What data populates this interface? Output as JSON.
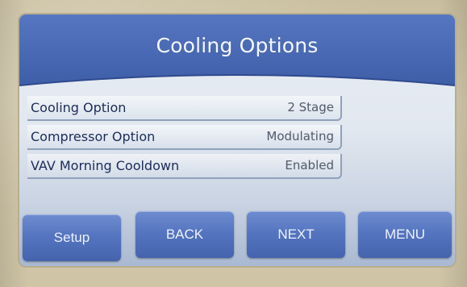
{
  "header": {
    "title": "Cooling Options"
  },
  "options": [
    {
      "label": "Cooling Option",
      "value": "2 Stage"
    },
    {
      "label": "Compressor Option",
      "value": "Modulating"
    },
    {
      "label": "VAV Morning Cooldown",
      "value": "Enabled"
    }
  ],
  "buttons": {
    "setup": "Setup",
    "back": "BACK",
    "next": "NEXT",
    "menu": "MENU"
  },
  "colors": {
    "header_blue": "#4a68b3",
    "button_blue": "#5575c0",
    "label_text": "#1c2c58",
    "value_text": "#505a6a"
  }
}
